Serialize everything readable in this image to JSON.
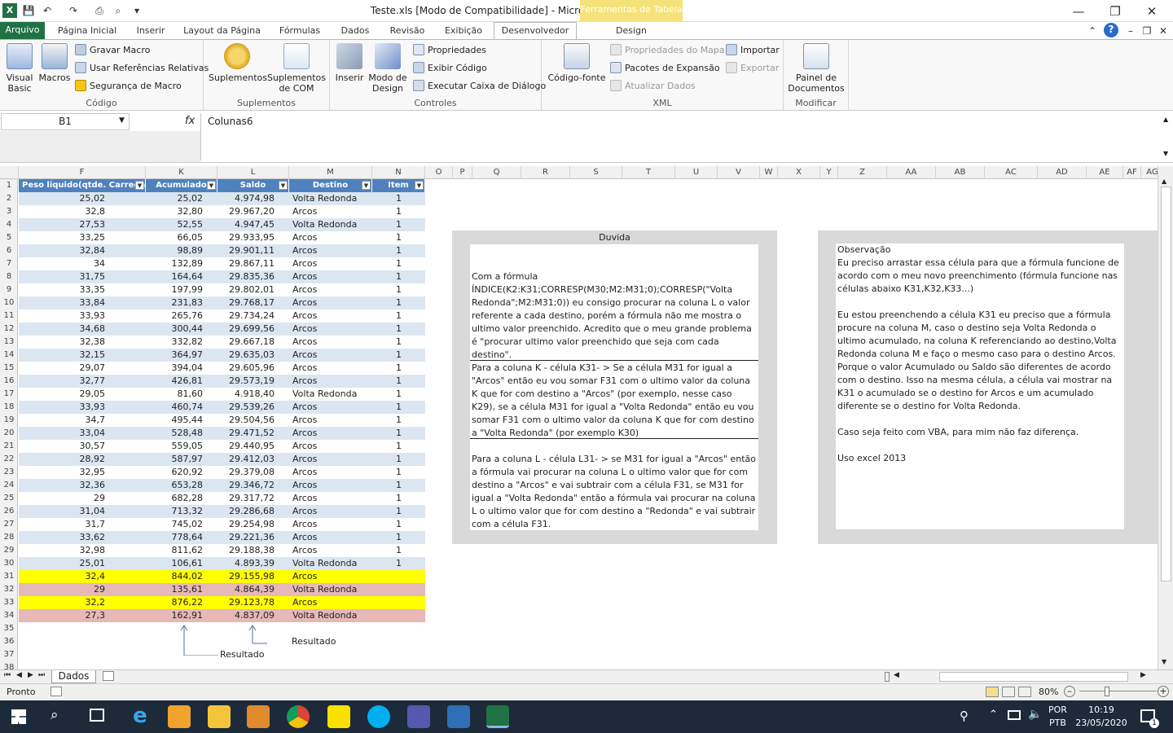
{
  "window": {
    "title": "Teste.xls  [Modo de Compatibilidade]  -  Microsoft Excel",
    "contextual_band": "Ferramentas de Tabela"
  },
  "tabs": [
    "Arquivo",
    "Página Inicial",
    "Inserir",
    "Layout da Página",
    "Fórmulas",
    "Dados",
    "Revisão",
    "Exibição",
    "Desenvolvedor",
    "Design"
  ],
  "ribbon": {
    "codigo": {
      "label": "Código",
      "visual_basic": "Visual\nBasic",
      "macros": "Macros",
      "gravar": "Gravar Macro",
      "usar_ref": "Usar Referências Relativas",
      "seguranca": "Segurança de Macro"
    },
    "suplementos": {
      "label": "Suplementos",
      "suplementos": "Suplementos",
      "com": "Suplementos\nde COM"
    },
    "controles": {
      "label": "Controles",
      "inserir": "Inserir",
      "modo": "Modo de\nDesign",
      "propriedades": "Propriedades",
      "exibir": "Exibir Código",
      "executar": "Executar Caixa de Diálogo"
    },
    "xml": {
      "label": "XML",
      "codigo_fonte": "Código-fonte",
      "prop_mapa": "Propriedades do Mapa",
      "pacotes": "Pacotes de Expansão",
      "atualizar": "Atualizar Dados",
      "importar": "Importar",
      "exportar": "Exportar"
    },
    "modificar": {
      "label": "Modificar",
      "painel": "Painel de\nDocumentos"
    }
  },
  "formula_bar": {
    "name_box": "B1",
    "fx": "fx",
    "content": "Colunas6"
  },
  "columns": [
    "F",
    "K",
    "L",
    "M",
    "N",
    "O",
    "P",
    "Q",
    "R",
    "S",
    "T",
    "U",
    "V",
    "W",
    "X",
    "Y",
    "Z",
    "AA",
    "AB",
    "AC",
    "AD",
    "AE",
    "AF",
    "AG"
  ],
  "table_headers": [
    "Peso liquido(qtde. Carregad",
    "Acumulado",
    "Saldo",
    "Destino",
    "Item"
  ],
  "rows": [
    [
      "25,02",
      "25,02",
      "4.974,98",
      "Volta Redonda",
      "1"
    ],
    [
      "32,8",
      "32,80",
      "29.967,20",
      "Arcos",
      "1"
    ],
    [
      "27,53",
      "52,55",
      "4.947,45",
      "Volta Redonda",
      "1"
    ],
    [
      "33,25",
      "66,05",
      "29.933,95",
      "Arcos",
      "1"
    ],
    [
      "32,84",
      "98,89",
      "29.901,11",
      "Arcos",
      "1"
    ],
    [
      "34",
      "132,89",
      "29.867,11",
      "Arcos",
      "1"
    ],
    [
      "31,75",
      "164,64",
      "29.835,36",
      "Arcos",
      "1"
    ],
    [
      "33,35",
      "197,99",
      "29.802,01",
      "Arcos",
      "1"
    ],
    [
      "33,84",
      "231,83",
      "29.768,17",
      "Arcos",
      "1"
    ],
    [
      "33,93",
      "265,76",
      "29.734,24",
      "Arcos",
      "1"
    ],
    [
      "34,68",
      "300,44",
      "29.699,56",
      "Arcos",
      "1"
    ],
    [
      "32,38",
      "332,82",
      "29.667,18",
      "Arcos",
      "1"
    ],
    [
      "32,15",
      "364,97",
      "29.635,03",
      "Arcos",
      "1"
    ],
    [
      "29,07",
      "394,04",
      "29.605,96",
      "Arcos",
      "1"
    ],
    [
      "32,77",
      "426,81",
      "29.573,19",
      "Arcos",
      "1"
    ],
    [
      "29,05",
      "81,60",
      "4.918,40",
      "Volta Redonda",
      "1"
    ],
    [
      "33,93",
      "460,74",
      "29.539,26",
      "Arcos",
      "1"
    ],
    [
      "34,7",
      "495,44",
      "29.504,56",
      "Arcos",
      "1"
    ],
    [
      "33,04",
      "528,48",
      "29.471,52",
      "Arcos",
      "1"
    ],
    [
      "30,57",
      "559,05",
      "29.440,95",
      "Arcos",
      "1"
    ],
    [
      "28,92",
      "587,97",
      "29.412,03",
      "Arcos",
      "1"
    ],
    [
      "32,95",
      "620,92",
      "29.379,08",
      "Arcos",
      "1"
    ],
    [
      "32,36",
      "653,28",
      "29.346,72",
      "Arcos",
      "1"
    ],
    [
      "29",
      "682,28",
      "29.317,72",
      "Arcos",
      "1"
    ],
    [
      "31,04",
      "713,32",
      "29.286,68",
      "Arcos",
      "1"
    ],
    [
      "31,7",
      "745,02",
      "29.254,98",
      "Arcos",
      "1"
    ],
    [
      "33,62",
      "778,64",
      "29.221,36",
      "Arcos",
      "1"
    ],
    [
      "32,98",
      "811,62",
      "29.188,38",
      "Arcos",
      "1"
    ],
    [
      "25,01",
      "106,61",
      "4.893,39",
      "Volta Redonda",
      "1"
    ],
    [
      "32,4",
      "844,02",
      "29.155,98",
      "Arcos",
      ""
    ],
    [
      "29",
      "135,61",
      "4.864,39",
      "Volta Redonda",
      ""
    ],
    [
      "32,2",
      "876,22",
      "29.123,78",
      "Arcos",
      ""
    ],
    [
      "27,3",
      "162,91",
      "4.837,09",
      "Volta Redonda",
      ""
    ]
  ],
  "row_styles": {
    "band_a": "#dce6f1",
    "band_b": "#ffffff",
    "yellow": "#ffff00",
    "pink": "#e6b8b7"
  },
  "annotations": {
    "resultado1": "Resultado",
    "resultado2": "Resultado"
  },
  "note_duvida": {
    "title": "Duvida",
    "p1": "Com a fórmula ÍNDICE(K2:K31;CORRESP(M30;M2:M31;0);CORRESP(\"Volta Redonda\";M2:M31;0)) eu consigo procurar na coluna L o valor referente a cada destino, porém a fórmula não me mostra o ultimo valor preenchido. Acredito que o meu grande problema é \"procurar ultimo valor preenchido que seja com cada destino\".",
    "p2": "Para a coluna K - célula K31- >  Se a célula  M31 for igual a \"Arcos\" então eu vou somar F31 com o ultimo valor da coluna K que for com destino a \"Arcos\" (por exemplo, nesse caso K29), se a célula  M31 for igual a \"Volta Redonda\" então eu vou somar F31 com o ultimo valor da coluna K  que for com destino a \"Volta Redonda\" (por exemplo K30)",
    "p3": "Para a coluna L - célula L31- > se  M31 for igual a \"Arcos\" então a fórmula vai procurar na coluna L o ultimo valor que for com destino a \"Arcos\" e vai subtrair com a célula F31, se M31 for igual a \"Volta Redonda\" então a fórmula vai procurar na coluna L o ultimo valor que for com destino a \"Redonda\" e vai subtrair com a célula F31."
  },
  "note_obs": {
    "p1": "Observação\nEu preciso arrastar essa célula para que a fórmula funcione de acordo com o meu novo preenchimento (fórmula funcione nas células abaixo K31,K32,K33...)",
    "p2": "Eu estou preenchendo a célula K31 eu preciso que a fórmula procure na coluna M, caso o destino seja Volta Redonda o ultimo acumulado, na coluna K referenciando ao destino,Volta Redonda coluna M e faço o mesmo caso para o destino Arcos. Porque o valor Acumulado ou Saldo são diferentes de acordo com o destino. Isso na mesma célula, a célula vai mostrar na K31 o acumulado se o destino for Arcos e um acumulado diferente se o destino for Volta Redonda.",
    "p3": "Caso seja feito com VBA, para mim não faz diferença.",
    "p4": "Uso excel 2013"
  },
  "sheet_tab": "Dados",
  "status": {
    "ready": "Pronto",
    "zoom": "80%"
  },
  "taskbar": {
    "lang1": "POR",
    "lang2": "PTB",
    "time": "10:19",
    "date": "23/05/2020",
    "notif": "1"
  }
}
